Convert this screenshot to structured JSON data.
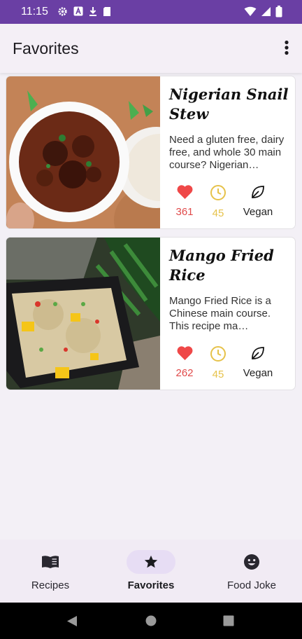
{
  "status_bar": {
    "time": "11:15",
    "icons": [
      "gear-icon",
      "text-a-icon",
      "download-icon",
      "sd-card-icon"
    ],
    "right_icons": [
      "wifi-icon",
      "signal-icon",
      "battery-icon"
    ]
  },
  "app_bar": {
    "title": "Favorites",
    "menu_icon": "more-vert-icon"
  },
  "recipes": [
    {
      "title": "Nigerian Snail Stew",
      "description": "Need a gluten free, dairy free, and whole 30 main course? Nigerian…",
      "likes": "361",
      "minutes": "45",
      "vegan_label": "Vegan"
    },
    {
      "title": "Mango Fried Rice",
      "description": "Mango Fried Rice is a Chinese main course. This recipe ma…",
      "likes": "262",
      "minutes": "45",
      "vegan_label": "Vegan"
    }
  ],
  "bottom_nav": {
    "items": [
      {
        "label": "Recipes",
        "icon": "book-icon",
        "active": false
      },
      {
        "label": "Favorites",
        "icon": "star-icon",
        "active": true
      },
      {
        "label": "Food Joke",
        "icon": "smile-icon",
        "active": false
      }
    ]
  },
  "colors": {
    "status_bar": "#6a3fa4",
    "like": "#e04a4a",
    "time": "#e6c24a",
    "active_pill": "#e7ddf4"
  }
}
